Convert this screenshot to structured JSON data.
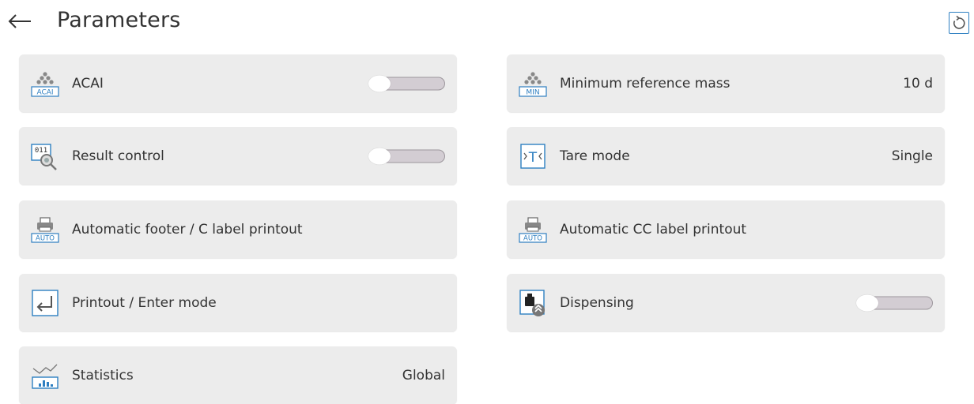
{
  "header": {
    "title": "Parameters",
    "back_icon": "arrow-left-icon",
    "reset_icon": "reset-icon"
  },
  "colors": {
    "tile_bg": "#ececec",
    "icon_blue": "#2e7fc1",
    "toggle_track": "#d3cdd3",
    "text": "#333333"
  },
  "parameters": [
    {
      "label": "ACAI",
      "icon": "acai-icon",
      "icon_text": "ACAI",
      "control": "toggle",
      "enabled": false
    },
    {
      "label": "Minimum reference mass",
      "icon": "min-mass-icon",
      "icon_text": "MIN",
      "control": "value",
      "value": "10 d"
    },
    {
      "label": "Result control",
      "icon": "result-control-icon",
      "icon_text": "011",
      "control": "toggle",
      "enabled": false
    },
    {
      "label": "Tare mode",
      "icon": "tare-mode-icon",
      "icon_text": "T",
      "control": "value",
      "value": "Single"
    },
    {
      "label": "Automatic footer / C label printout",
      "icon": "auto-printer-icon",
      "icon_text": "AUTO",
      "control": "none"
    },
    {
      "label": "Automatic CC label printout",
      "icon": "auto-printer-icon",
      "icon_text": "AUTO",
      "control": "none"
    },
    {
      "label": "Printout / Enter mode",
      "icon": "enter-icon",
      "control": "none"
    },
    {
      "label": "Dispensing",
      "icon": "dispensing-icon",
      "control": "toggle",
      "enabled": false
    },
    {
      "label": "Statistics",
      "icon": "statistics-icon",
      "control": "value",
      "value": "Global"
    }
  ]
}
